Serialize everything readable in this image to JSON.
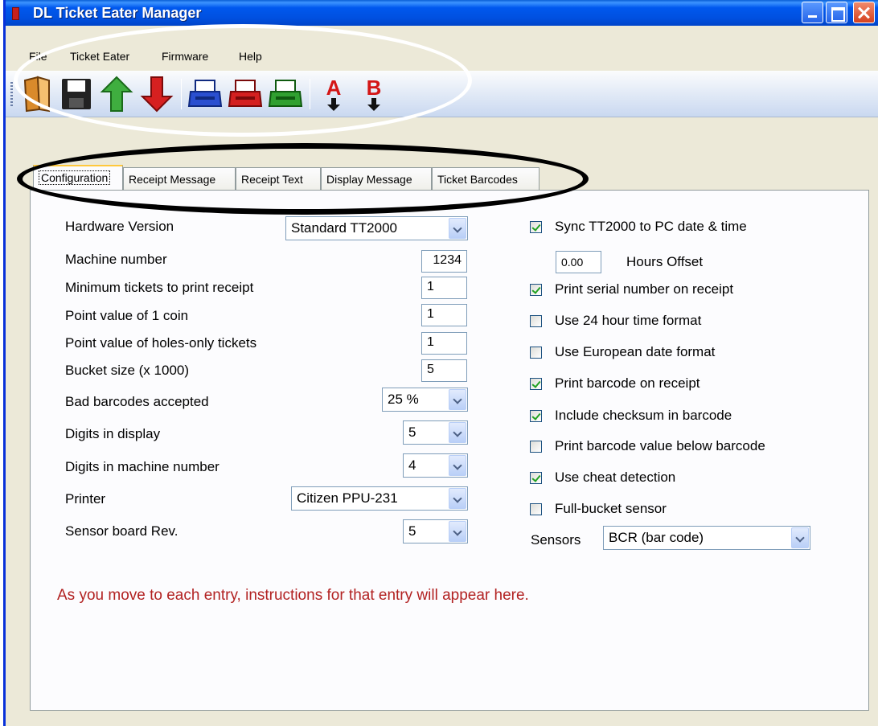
{
  "window": {
    "title": "DL Ticket Eater Manager"
  },
  "menu": [
    {
      "label": "File"
    },
    {
      "label": "Ticket Eater"
    },
    {
      "label": "Firmware"
    },
    {
      "label": "Help"
    }
  ],
  "toolbar": {
    "buttons": [
      {
        "icon": "open-folder-icon",
        "color": "#f0a030"
      },
      {
        "icon": "save-disk-icon",
        "color": "#1a1a1a"
      },
      {
        "icon": "upload-arrow-icon",
        "color": "#2e9a2e"
      },
      {
        "icon": "download-arrow-icon",
        "color": "#cc1a1a"
      },
      {
        "icon": "blue-printer-icon",
        "color": "#1f3fb8"
      },
      {
        "icon": "red-printer-icon",
        "color": "#c81a1a"
      },
      {
        "icon": "green-printer-icon",
        "color": "#2a9a2a"
      },
      {
        "icon": "download-a-icon",
        "letter": "A",
        "color": "#d41616"
      },
      {
        "icon": "download-b-icon",
        "letter": "B",
        "color": "#d41616"
      }
    ]
  },
  "tabs": [
    {
      "label": "Configuration"
    },
    {
      "label": "Receipt Message"
    },
    {
      "label": "Receipt Text"
    },
    {
      "label": "Display Message"
    },
    {
      "label": "Ticket Barcodes"
    }
  ],
  "config": {
    "hardware_version": {
      "label": "Hardware Version",
      "value": "Standard TT2000"
    },
    "machine_number": {
      "label": "Machine number",
      "value": "1234"
    },
    "min_tickets": {
      "label": "Minimum tickets to print receipt",
      "value": "1"
    },
    "coin_value": {
      "label": "Point value of 1 coin",
      "value": "1"
    },
    "holes_value": {
      "label": "Point value of holes-only tickets",
      "value": "1"
    },
    "bucket_size": {
      "label": "Bucket size (x 1000)",
      "value": "5"
    },
    "bad_barcodes": {
      "label": "Bad barcodes accepted",
      "value": "25 %"
    },
    "display_digits": {
      "label": "Digits in display",
      "value": "5"
    },
    "machine_digits": {
      "label": "Digits in machine number",
      "value": "4"
    },
    "printer": {
      "label": "Printer",
      "value": "Citizen PPU-231"
    },
    "sensor_rev": {
      "label": "Sensor board Rev.",
      "value": "5"
    }
  },
  "options": {
    "sync": {
      "label": "Sync TT2000 to PC date & time",
      "checked": true
    },
    "hours_offset": {
      "label": "Hours Offset",
      "value": "0.00"
    },
    "serial": {
      "label": "Print serial number on receipt",
      "checked": true
    },
    "time24": {
      "label": "Use 24 hour time format",
      "checked": false
    },
    "eurodate": {
      "label": "Use European date format",
      "checked": false
    },
    "barcode": {
      "label": "Print barcode on receipt",
      "checked": true
    },
    "checksum": {
      "label": "Include checksum in barcode",
      "checked": true
    },
    "barcode_value": {
      "label": "Print barcode value below barcode",
      "checked": false
    },
    "cheat": {
      "label": "Use cheat detection",
      "checked": true
    },
    "full_bucket": {
      "label": "Full-bucket sensor",
      "checked": false
    },
    "sensors": {
      "label": "Sensors",
      "value": "BCR (bar code)"
    }
  },
  "hint": "As you move to each entry, instructions for that entry will appear here."
}
